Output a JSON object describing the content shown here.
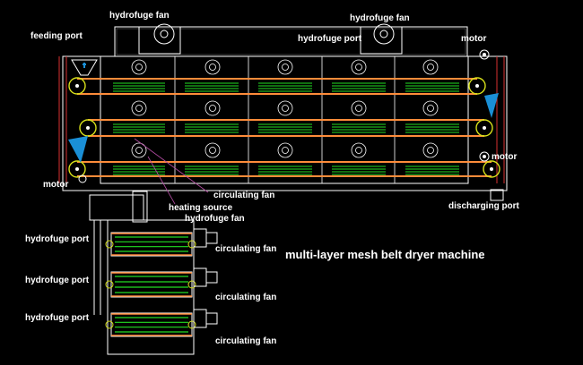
{
  "labels": {
    "hydrofuge_fan_top_left": "hydrofuge fan",
    "hydrofuge_fan_top_right": "hydrofuge fan",
    "feeding_port": "feeding port",
    "hydrofuge_port_top": "hydrofuge port",
    "motor_top_right": "motor",
    "motor_right": "motor",
    "motor_left": "motor",
    "circulating_fan_main": "circulating fan",
    "heating_source": "heating source",
    "hydrofuge_fan_bottom": "hydrofuge fan",
    "discharging_port": "discharging port",
    "title": "multi-layer mesh belt dryer machine",
    "hydrofuge_port_1": "hydrofuge port",
    "hydrofuge_port_2": "hydrofuge port",
    "hydrofuge_port_3": "hydrofuge port",
    "circulating_fan_1": "circulating fan",
    "circulating_fan_2": "circulating fan",
    "circulating_fan_3": "circulating fan"
  },
  "colors": {
    "background": "#000000",
    "frame": "#ffffff",
    "belt": "#ff8c3a",
    "heater": "#22dd22",
    "roller": "#d7e01a",
    "triangle": "#1a8fd6",
    "wall": "#d83030",
    "guide": "#b04aa0"
  }
}
